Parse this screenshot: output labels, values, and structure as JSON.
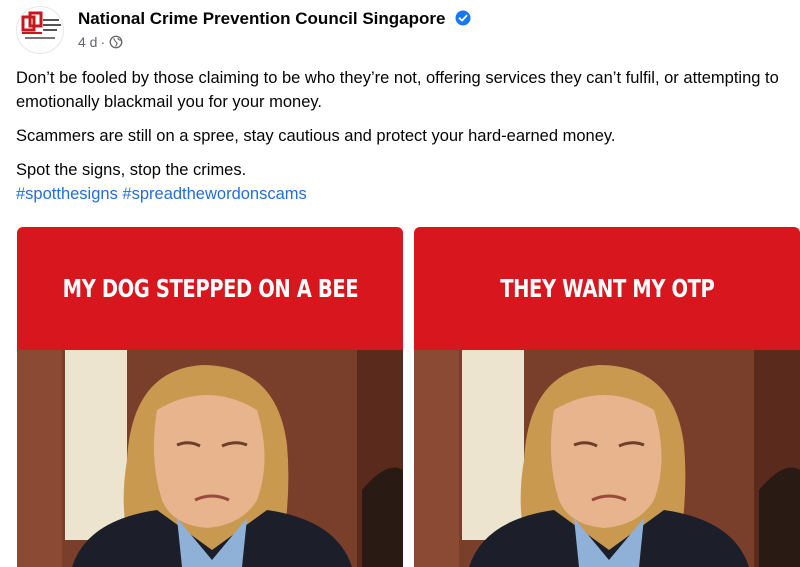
{
  "post": {
    "page_name": "National Crime Prevention Council Singapore",
    "timestamp": "4 d",
    "separator": "·",
    "visibility_icon": "globe-icon",
    "verified_icon": "verified-badge-icon",
    "paragraphs": [
      "Don’t be fooled by those claiming to be who they’re not, offering services they can’t fulfil, or attempting to emotionally blackmail you for your money.",
      "Scammers are still on a spree, stay cautious and protect your hard-earned money.",
      "Spot the signs, stop the crimes."
    ],
    "hashtags": [
      "#spotthesigns",
      "#spreadthewordonscams"
    ]
  },
  "images": [
    {
      "caption": "MY DOG STEPPED ON A BEE"
    },
    {
      "caption": "THEY WANT MY OTP"
    }
  ],
  "colors": {
    "banner_red": "#d7161e",
    "link_blue": "#216fdb",
    "verified_blue": "#1877f2",
    "meta_gray": "#65676b"
  }
}
